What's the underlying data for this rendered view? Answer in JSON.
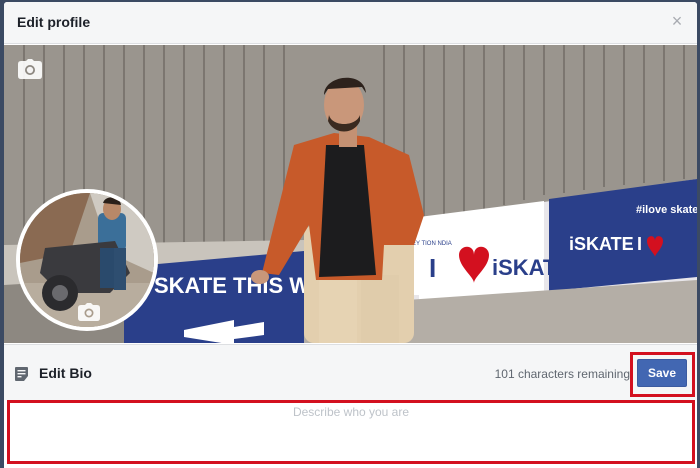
{
  "dialog": {
    "title": "Edit profile",
    "close_icon": "close-icon"
  },
  "cover": {
    "camera_icon": "camera-icon",
    "banner_texts": [
      "SKATE THIS WAY",
      "I",
      "iSKATE",
      "iSKATE",
      "#ilove skate",
      "I",
      "KEY TION NDIA"
    ]
  },
  "avatar": {
    "camera_icon": "camera-icon"
  },
  "bio": {
    "icon": "note-icon",
    "label": "Edit Bio",
    "remaining": "101 characters remaining",
    "save_label": "Save",
    "placeholder": "Describe who you are",
    "value": ""
  },
  "colors": {
    "save_button": "#4267b2",
    "highlight": "#d3101f",
    "header_bg": "#f5f6f7"
  }
}
